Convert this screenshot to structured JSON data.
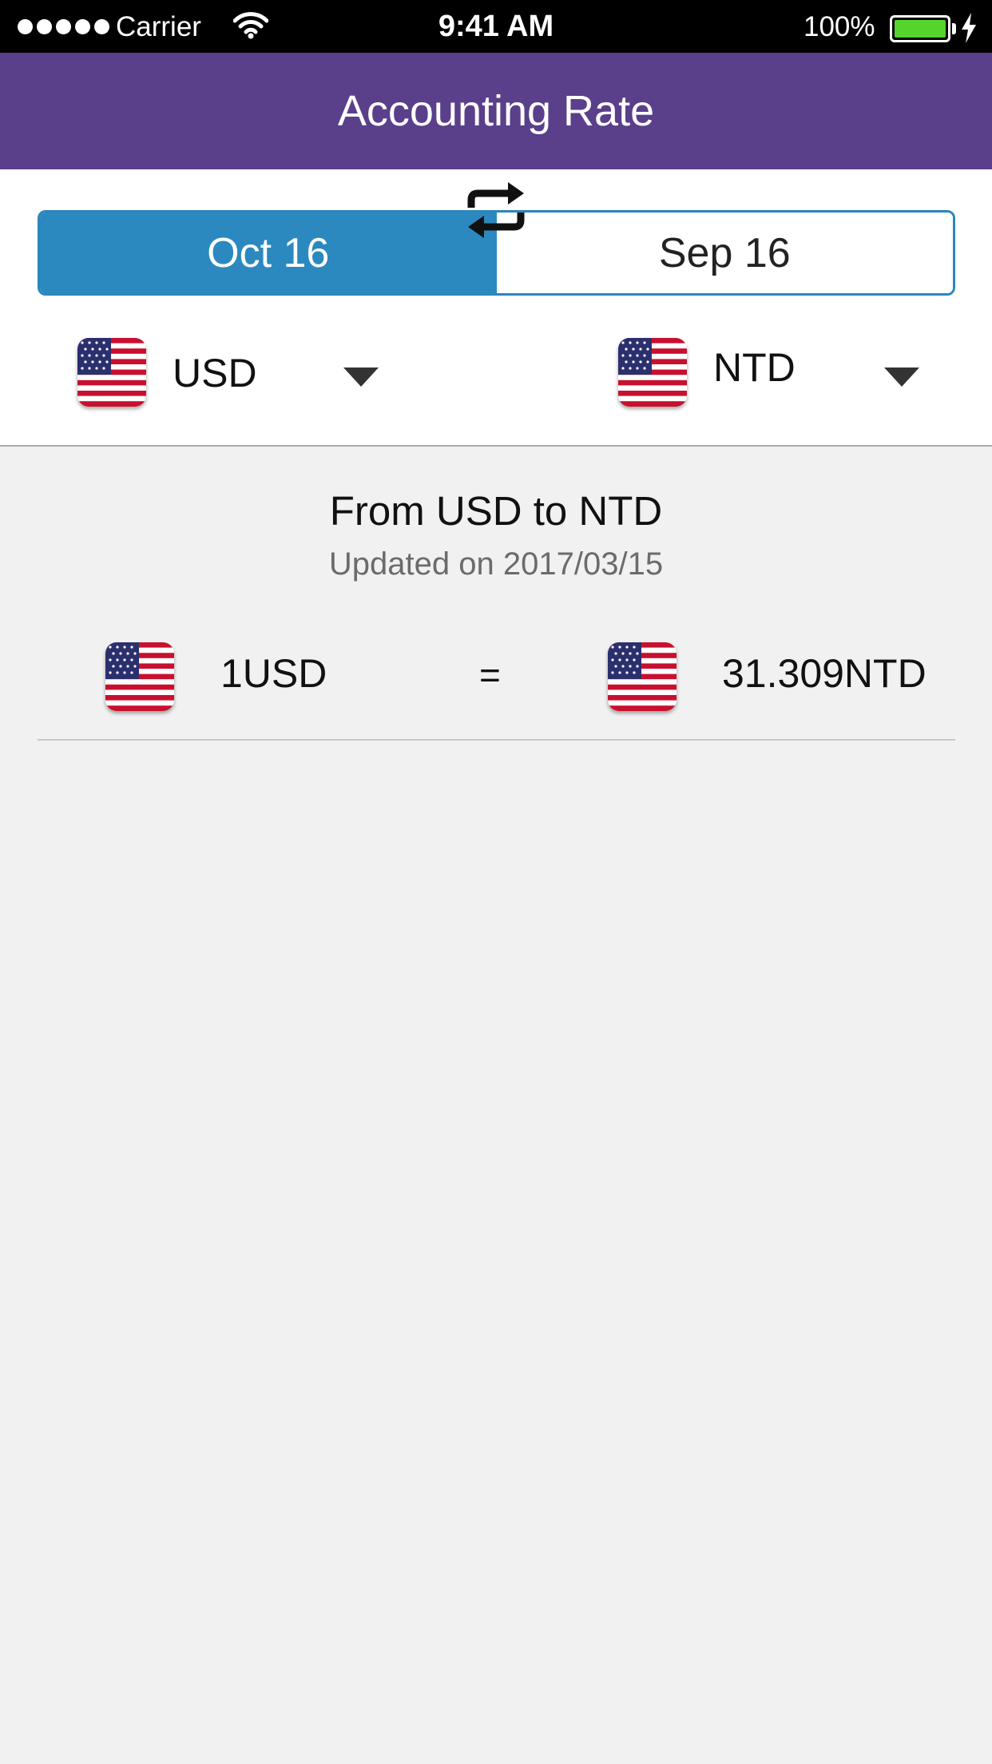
{
  "status_bar": {
    "carrier": "Carrier",
    "time": "9:41 AM",
    "battery_percent": "100%",
    "signal_bars": 5,
    "battery_level": 1.0,
    "battery_color": "#55d42e"
  },
  "nav": {
    "title": "Accounting Rate",
    "color": "#5a3f8b"
  },
  "period_tabs": [
    {
      "label": "Oct 16",
      "selected": true
    },
    {
      "label": "Sep 16",
      "selected": false
    }
  ],
  "accent_color": "#2b89bf",
  "from_currency": {
    "code": "USD",
    "flag_icon": "us-flag-icon"
  },
  "to_currency": {
    "code": "NTD",
    "flag_icon": "us-flag-icon"
  },
  "swap_icon": "swap-arrows-icon",
  "result": {
    "title": "From USD to NTD",
    "updated": "Updated on 2017/03/15",
    "from_amount": "1USD",
    "equals": "=",
    "to_amount": "31.309NTD"
  }
}
